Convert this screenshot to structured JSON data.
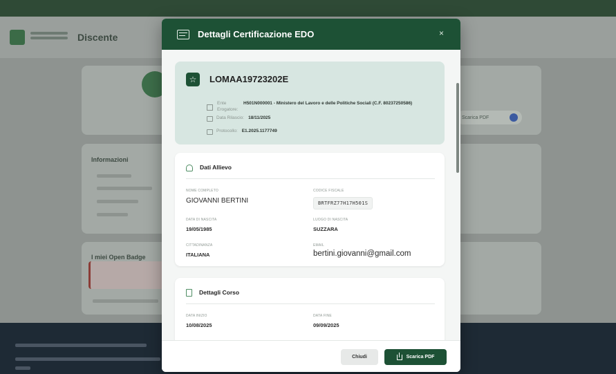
{
  "background": {
    "header_title": "Discente",
    "card2_title": "Informazioni",
    "card3_title": "I miei Open Badge",
    "pill_label": "Scarica PDF"
  },
  "modal": {
    "title": "Dettagli Certificazione EDO",
    "close_label": "×",
    "certificate": {
      "code": "LOMAA19723202E",
      "ente_label": "Ente Erogatore:",
      "ente_value": "H501N000001 - Ministero del Lavoro e delle Politiche Sociali (C.F. 80237250586)",
      "data_rilascio_label": "Data Rilascio:",
      "data_rilascio_value": "18/11/2025",
      "protocollo_label": "Protocollo:",
      "protocollo_value": "E1.2025.1177749"
    },
    "dati_allievo": {
      "title": "Dati Allievo",
      "nome_label": "Nome Completo",
      "nome_value": "GIOVANNI BERTINI",
      "cf_label": "Codice Fiscale",
      "cf_value": "BRTFRZ77H17H501S",
      "nascita_label": "Data di Nascita",
      "nascita_value": "19/05/1985",
      "luogo_label": "Luogo di Nascita",
      "luogo_value": "SUZZARA",
      "cittadinanza_label": "Cittadinanza",
      "cittadinanza_value": "ITALIANA",
      "email_label": "Email",
      "email_value": "bertini.giovanni@gmail.com"
    },
    "dettagli_corso": {
      "title": "Dettagli Corso",
      "inizio_label": "Data Inizio",
      "inizio_value": "10/08/2025",
      "fine_label": "Data Fine",
      "fine_value": "09/09/2025"
    },
    "footer": {
      "chiudi_label": "Chiudi",
      "pdf_label": "Scarica PDF"
    }
  },
  "colors": {
    "primary": "#1d5135",
    "cert_bg": "#d7e6e1"
  }
}
